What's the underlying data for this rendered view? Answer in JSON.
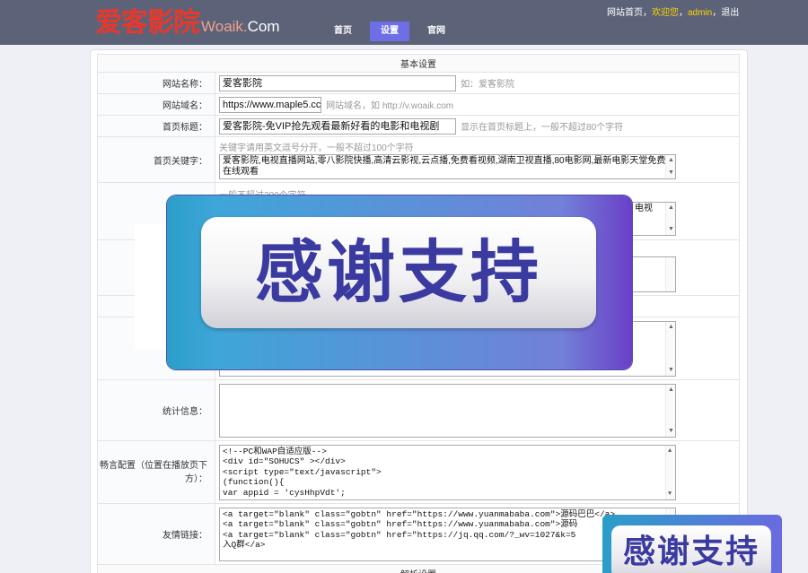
{
  "header": {
    "logo_cn": "爱客影院",
    "logo_en_prefix": "Woaik.",
    "logo_en_suffix": "Com",
    "nav": [
      "首页",
      "设置",
      "官网"
    ],
    "active_nav": "设置",
    "top_home": "网站首页",
    "top_sep1": "，",
    "top_welcome": "欢迎您",
    "top_sep2": "，",
    "top_user": "admin",
    "top_sep3": "，",
    "top_logout": "退出"
  },
  "section_basic": "基本设置",
  "section_parse": "解析设置",
  "fields": {
    "site_name": {
      "label": "网站名称：",
      "value": "爱客影院",
      "hint": "如：爱客影院"
    },
    "site_domain": {
      "label": "网站域名：",
      "value": "https://www.maple5.cc",
      "hint": "网站域名，如 http://v.woaik.com"
    },
    "home_title": {
      "label": "首页标题：",
      "value": "爱客影院-免VIP抢先观看最新好看的电影和电视剧",
      "hint": "显示在首页标题上，一般不超过80个字符"
    },
    "home_keywords": {
      "label": "首页关键字：",
      "hint": "关键字请用英文逗号分开，一般不超过100个字符",
      "value": "爱客影院,电视直播网站,零八影院快播,高清云影视,云点播,免费看视频,湖南卫视直播,80电影网,最新电影天堂免费在线观看"
    },
    "home_desc": {
      "hint": "一般不超过200个字符",
      "value_tail": "电视"
    },
    "stats": {
      "label": "统计信息：",
      "value": ""
    },
    "changyan": {
      "label": "畅言配置（位置在播放页下方）：",
      "lines": [
        "<!--PC和WAP自适应版-->",
        "<div id=\"SOHUCS\" ></div>",
        "<script type=\"text/javascript\">",
        "(function(){",
        "var appid = 'cysHhpVdt';"
      ]
    },
    "friend_links": {
      "label": "友情链接：",
      "lines": [
        "<a target=\"blank\" class=\"gobtn\" href=\"https://www.yuanmababa.com\">源码巴巴</a>",
        "<a target=\"blank\" class=\"gobtn\" href=\"https://www.yuanmababa.com\">源码",
        "<a target=\"blank\" class=\"gobtn\" href=\"https://jq.qq.com/?_wv=1027&k=5",
        "入Q群</a>"
      ]
    }
  },
  "overlay": {
    "big_text": "感谢支持",
    "small_text": "感谢支持"
  },
  "colors": {
    "header_bg": "#5c6378",
    "active_nav": "#6e6ee6",
    "logo_red": "#e8382c",
    "welcome_yellow": "#ffd200",
    "overlay_text": "#3a3aa0"
  }
}
